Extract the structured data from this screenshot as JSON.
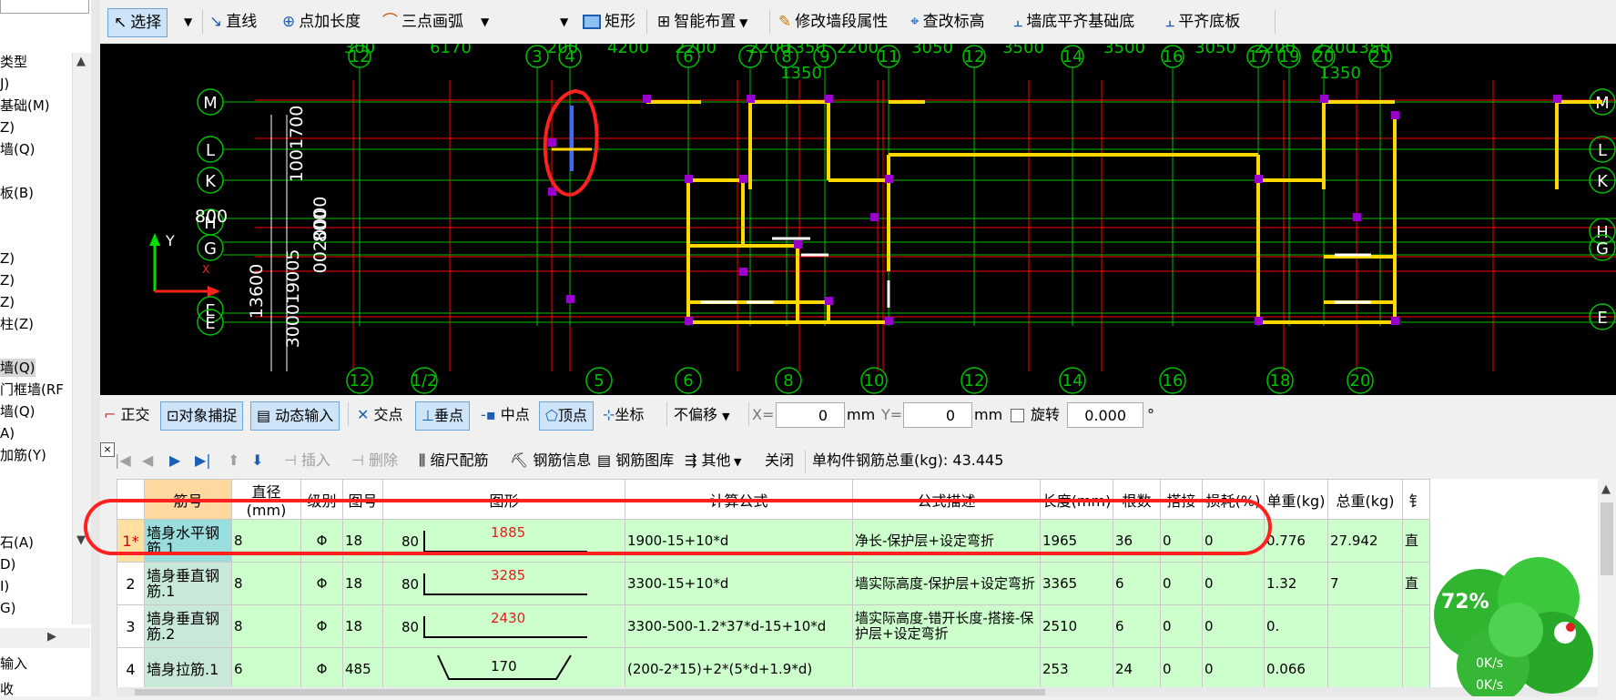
{
  "left_panel": {
    "items": [
      "类型",
      "J)",
      "基础(M)",
      "Z)",
      "墙(Q)",
      "",
      "板(B)",
      "",
      "",
      "Z)",
      "Z)",
      "Z)",
      "柱(Z)",
      "",
      "墙(Q)",
      "门框墙(RF",
      "墙(Q)",
      "A)",
      "加筋(Y)",
      "",
      "",
      "",
      "石(A)",
      "D)",
      "I)",
      "G)"
    ],
    "bottom_items": [
      "输入",
      "收"
    ]
  },
  "toolbar": {
    "select_label": "选择",
    "line_label": "直线",
    "point_length_label": "点加长度",
    "arc_label": "三点画弧",
    "rect_label": "矩形",
    "smart_layout_label": "智能布置",
    "modify_wall_label": "修改墙段属性",
    "check_elev_label": "查改标高",
    "wall_bottom_label": "墙底平齐基础底",
    "flush_slab_label": "平齐底板"
  },
  "canvas": {
    "top_dims": [
      "300",
      "6170",
      "200",
      "4200",
      "2200",
      "2200",
      "1350",
      "2200",
      "3050",
      "3500",
      "3500",
      "3050",
      "2200",
      "2200",
      "1350"
    ],
    "top_dims2": [
      "1350",
      "1350"
    ],
    "top_axes": [
      "12",
      "3",
      "4",
      "6",
      "7",
      "8",
      "9",
      "11",
      "12",
      "14",
      "16",
      "17",
      "19",
      "20",
      "21"
    ],
    "bottom_axes": [
      "12",
      "1/2",
      "5",
      "6",
      "8",
      "10",
      "12",
      "14",
      "16",
      "18",
      "20"
    ],
    "left_axes": [
      "M",
      "L",
      "K",
      "H",
      "G",
      "E",
      "E"
    ],
    "right_axes": [
      "M",
      "L",
      "K",
      "H",
      "G",
      "E"
    ],
    "left_vertical_dims": [
      "1001700",
      "0020000",
      "800",
      "800",
      "13600",
      "300019005"
    ],
    "y_axis_label": "Y",
    "x_axis_label": "X"
  },
  "snapbar": {
    "ortho_label": "正交",
    "snap_label": "对象捕捉",
    "dynamic_label": "动态输入",
    "intersect_label": "交点",
    "perp_label": "垂点",
    "mid_label": "中点",
    "vertex_label": "顶点",
    "coord_label": "坐标",
    "offset_value": "不偏移",
    "x_label": "X=",
    "x_value": "0",
    "x_unit": "mm",
    "y_label": "Y=",
    "y_value": "0",
    "y_unit": "mm",
    "rotate_label": "旋转",
    "rotate_value": "0.000",
    "degree": "°"
  },
  "rebarbar": {
    "insert_label": "插入",
    "delete_label": "删除",
    "scale_label": "缩尺配筋",
    "info_label": "钢筋信息",
    "lib_label": "钢筋图库",
    "other_label": "其他",
    "close_label": "关闭",
    "total_label": "单构件钢筋总重(kg): 43.445"
  },
  "table": {
    "headers": [
      "",
      "筋号",
      "直径(mm)",
      "级别",
      "图号",
      "图形",
      "计算公式",
      "公式描述",
      "长度(mm)",
      "根数",
      "搭接",
      "损耗(%)",
      "单重(kg)",
      "总重(kg)",
      "钅"
    ],
    "rows": [
      {
        "num": "1*",
        "name": "墙身水平钢筋.1",
        "dia": "8",
        "grade": "Φ",
        "fig": "18",
        "shape_left": "80",
        "shape_num": "1885",
        "formula": "1900-15+10*d",
        "desc": "净长-保护层+设定弯折",
        "len": "1965",
        "count": "36",
        "lap": "0",
        "loss": "0",
        "unit_w": "0.776",
        "total_w": "27.942",
        "extra": "直"
      },
      {
        "num": "2",
        "name": "墙身垂直钢筋.1",
        "dia": "8",
        "grade": "Φ",
        "fig": "18",
        "shape_left": "80",
        "shape_num": "3285",
        "formula": "3300-15+10*d",
        "desc": "墙实际高度-保护层+设定弯折",
        "len": "3365",
        "count": "6",
        "lap": "0",
        "loss": "0",
        "unit_w": "1.32",
        "total_w": "7",
        "extra": "直"
      },
      {
        "num": "3",
        "name": "墙身垂直钢筋.2",
        "dia": "8",
        "grade": "Φ",
        "fig": "18",
        "shape_left": "80",
        "shape_num": "2430",
        "formula": "3300-500-1.2*37*d-15+10*d",
        "desc": "墙实际高度-错开长度-搭接-保护层+设定弯折",
        "len": "2510",
        "count": "6",
        "lap": "0",
        "loss": "0",
        "unit_w": "0.",
        "total_w": "",
        "extra": ""
      },
      {
        "num": "4",
        "name": "墙身拉筋.1",
        "dia": "6",
        "grade": "Φ",
        "fig": "485",
        "shape_left": "",
        "shape_num": "170",
        "formula": "(200-2*15)+2*(5*d+1.9*d)",
        "desc": "",
        "len": "253",
        "count": "24",
        "lap": "0",
        "loss": "0",
        "unit_w": "0.066",
        "total_w": "",
        "extra": ""
      }
    ]
  },
  "widget": {
    "percent": "72%",
    "speed_up": "0K/s",
    "speed_down": "0K/s"
  },
  "colors": {
    "canvas_bg": "#000000",
    "axis_green": "#00c000",
    "grid_red": "#ff0000",
    "wall_yellow": "#ffd800",
    "wall_purple": "#9900cc",
    "annotation_red": "#ff2020",
    "row_green": "#ccffcc"
  }
}
